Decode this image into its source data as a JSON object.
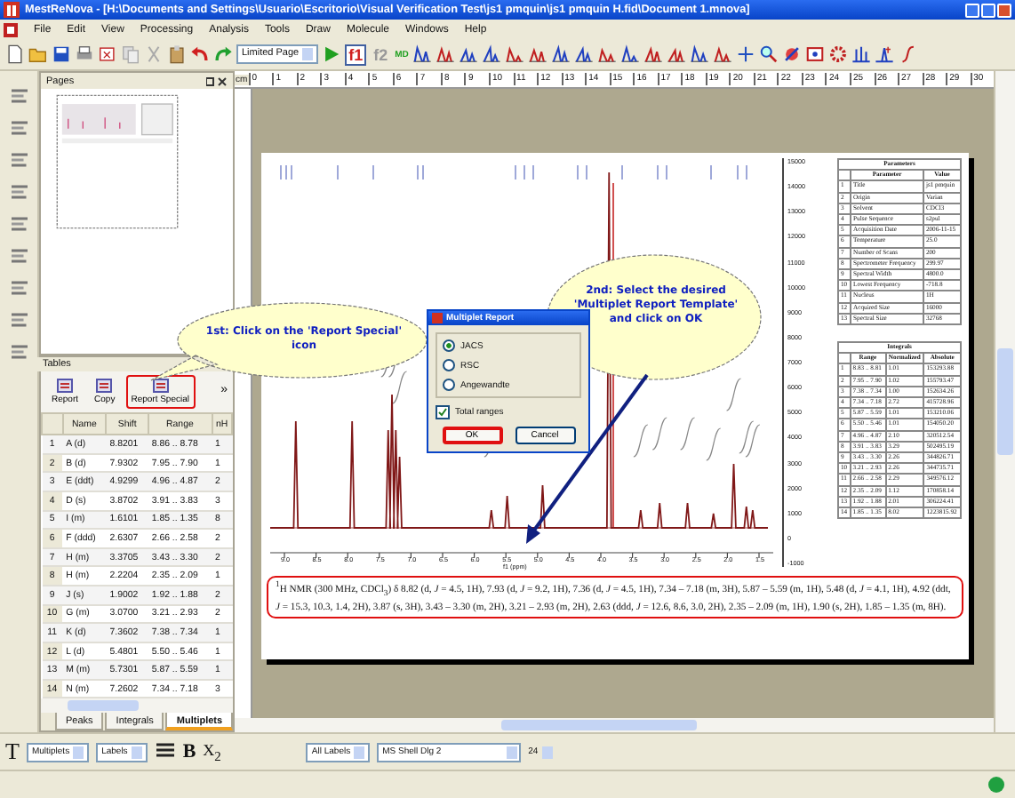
{
  "window": {
    "title": "MestReNova - [H:\\Documents and Settings\\Usuario\\Escritorio\\Visual Verification Test\\js1 pmquin\\js1 pmquin H.fid\\Document 1.mnova]"
  },
  "menu": [
    "File",
    "Edit",
    "View",
    "Processing",
    "Analysis",
    "Tools",
    "Draw",
    "Molecule",
    "Windows",
    "Help"
  ],
  "toolbar": {
    "page_mode": "Limited Page",
    "dimension_buttons": [
      {
        "label": "f1",
        "selected": true
      },
      {
        "label": "f2",
        "selected": false
      }
    ],
    "md_button": "MD"
  },
  "ruler": {
    "unit": "cm",
    "marks": [
      "0",
      "1",
      "2",
      "3",
      "4",
      "5",
      "6",
      "7",
      "8",
      "9",
      "10",
      "11",
      "12",
      "13",
      "14",
      "15",
      "16",
      "17",
      "18",
      "19",
      "20",
      "21",
      "22",
      "23",
      "24",
      "25",
      "26",
      "27",
      "28",
      "29",
      "30"
    ]
  },
  "pages_panel": {
    "title": "Pages"
  },
  "tables_panel": {
    "title": "Tables",
    "more": "»",
    "buttons": [
      {
        "label": "Report",
        "highlighted": false
      },
      {
        "label": "Copy",
        "highlighted": false
      },
      {
        "label": "Report Special",
        "highlighted": true
      }
    ],
    "columns": [
      "Name",
      "Shift",
      "Range",
      "nH"
    ],
    "rows": [
      {
        "index": "1",
        "name": "A (d)",
        "shift": "8.8201",
        "range": "8.86 .. 8.78",
        "nh": "1"
      },
      {
        "index": "2",
        "name": "B (d)",
        "shift": "7.9302",
        "range": "7.95 .. 7.90",
        "nh": "1"
      },
      {
        "index": "3",
        "name": "E (ddt)",
        "shift": "4.9299",
        "range": "4.96 .. 4.87",
        "nh": "2"
      },
      {
        "index": "4",
        "name": "D (s)",
        "shift": "3.8702",
        "range": "3.91 .. 3.83",
        "nh": "3"
      },
      {
        "index": "5",
        "name": "I (m)",
        "shift": "1.6101",
        "range": "1.85 .. 1.35",
        "nh": "8"
      },
      {
        "index": "6",
        "name": "F (ddd)",
        "shift": "2.6307",
        "range": "2.66 .. 2.58",
        "nh": "2"
      },
      {
        "index": "7",
        "name": "H (m)",
        "shift": "3.3705",
        "range": "3.43 .. 3.30",
        "nh": "2"
      },
      {
        "index": "8",
        "name": "H (m)",
        "shift": "2.2204",
        "range": "2.35 .. 2.09",
        "nh": "1"
      },
      {
        "index": "9",
        "name": "J (s)",
        "shift": "1.9002",
        "range": "1.92 .. 1.88",
        "nh": "2"
      },
      {
        "index": "10",
        "name": "G (m)",
        "shift": "3.0700",
        "range": "3.21 .. 2.93",
        "nh": "2"
      },
      {
        "index": "11",
        "name": "K (d)",
        "shift": "7.3602",
        "range": "7.38 .. 7.34",
        "nh": "1"
      },
      {
        "index": "12",
        "name": "L (d)",
        "shift": "5.4801",
        "range": "5.50 .. 5.46",
        "nh": "1"
      },
      {
        "index": "13",
        "name": "M (m)",
        "shift": "5.7301",
        "range": "5.87 .. 5.59",
        "nh": "1"
      },
      {
        "index": "14",
        "name": "N (m)",
        "shift": "7.2602",
        "range": "7.34 .. 7.18",
        "nh": "3"
      }
    ],
    "tabs": [
      {
        "label": "Peaks",
        "selected": false
      },
      {
        "label": "Integrals",
        "selected": false
      },
      {
        "label": "Multiplets",
        "selected": true
      }
    ]
  },
  "document": {
    "spectrum": {
      "xticks": [
        "9.0",
        "8.5",
        "8.0",
        "7.5",
        "7.0",
        "6.5",
        "6.0",
        "5.5",
        "5.0",
        "4.5",
        "4.0",
        "3.5",
        "3.0",
        "2.5",
        "2.0",
        "1.5"
      ],
      "xlabel": "f1 (ppm)",
      "yticks": [
        "15000",
        "14000",
        "13000",
        "12000",
        "11000",
        "10000",
        "9000",
        "8000",
        "7000",
        "6000",
        "5000",
        "4000",
        "3000",
        "2000",
        "1000",
        "0",
        "-1000"
      ]
    },
    "parameters": {
      "title": "Parameters",
      "columns": [
        "",
        "Parameter",
        "Value"
      ],
      "rows": [
        [
          "1",
          "Title",
          "js1 pmquin"
        ],
        [
          "2",
          "Origin",
          "Varian"
        ],
        [
          "3",
          "Solvent",
          "CDCl3"
        ],
        [
          "4",
          "Pulse Sequence",
          "s2pul"
        ],
        [
          "5",
          "Acquisition Date",
          "2006-11-15"
        ],
        [
          "6",
          "Temperature",
          "25.0"
        ],
        [
          "7",
          "Number of Scans",
          "200"
        ],
        [
          "8",
          "Spectrometer Frequency",
          "299.97"
        ],
        [
          "9",
          "Spectral Width",
          "4800.0"
        ],
        [
          "10",
          "Lowest Frequency",
          "-718.8"
        ],
        [
          "11",
          "Nucleus",
          "1H"
        ],
        [
          "12",
          "Acquired Size",
          "16000"
        ],
        [
          "13",
          "Spectral Size",
          "32768"
        ]
      ]
    },
    "integrals": {
      "title": "Integrals",
      "columns": [
        "",
        "Range",
        "Normalized",
        "Absolute"
      ],
      "rows": [
        [
          "1",
          "8.83 .. 8.81",
          "1.01",
          "153293.88"
        ],
        [
          "2",
          "7.95 .. 7.90",
          "1.02",
          "155793.47"
        ],
        [
          "3",
          "7.38 .. 7.34",
          "1.00",
          "152634.26"
        ],
        [
          "4",
          "7.34 .. 7.18",
          "2.72",
          "415728.96"
        ],
        [
          "5",
          "5.87 .. 5.59",
          "1.01",
          "153210.06"
        ],
        [
          "6",
          "5.50 .. 5.46",
          "1.01",
          "154050.20"
        ],
        [
          "7",
          "4.96 .. 4.87",
          "2.10",
          "320512.54"
        ],
        [
          "8",
          "3.91 .. 3.83",
          "3.29",
          "502495.19"
        ],
        [
          "9",
          "3.43 .. 3.30",
          "2.26",
          "344826.71"
        ],
        [
          "10",
          "3.21 .. 2.93",
          "2.26",
          "344735.71"
        ],
        [
          "11",
          "2.66 .. 2.58",
          "2.29",
          "349576.12"
        ],
        [
          "12",
          "2.35 .. 2.09",
          "1.12",
          "170858.14"
        ],
        [
          "13",
          "1.92 .. 1.88",
          "2.01",
          "306224.41"
        ],
        [
          "14",
          "1.85 .. 1.35",
          "8.02",
          "1223815.92"
        ]
      ]
    },
    "nmr_text": "$^{1}$H NMR (300 MHz, CDCl$_{3}$) δ 8.82 (d, *J* = 4.5, 1H), 7.93 (d, *J* = 9.2, 1H), 7.36 (d, *J* = 4.5, 1H), 7.34 – 7.18 (m, 3H), 5.87 – 5.59 (m, 1H), 5.48 (d, *J* = 4.1, 1H), 4.92 (ddt, *J* = 15.3, 10.3, 1.4, 2H), 3.87 (s, 3H), 3.43 – 3.30 (m, 2H), 3.21 – 2.93 (m, 2H), 2.63 (ddd, *J* = 12.6, 8.6, 3.0, 2H), 2.35 – 2.09 (m, 1H), 1.90 (s, 2H), 1.85 – 1.35 (m, 8H).",
    "nmr_highlighted": true
  },
  "dialog": {
    "title": "Multiplet Report",
    "templates": [
      {
        "label": "JACS",
        "selected": true
      },
      {
        "label": "RSC",
        "selected": false
      },
      {
        "label": "Angewandte",
        "selected": false
      }
    ],
    "total_ranges": {
      "label": "Total ranges",
      "checked": true
    },
    "buttons": [
      {
        "label": "OK",
        "highlighted": true
      },
      {
        "label": "Cancel",
        "highlighted": false
      }
    ]
  },
  "callouts": [
    {
      "text": "1st: Click on the 'Report Special' icon"
    },
    {
      "text": "2nd: Select the desired 'Multiplet Report Template' and click on OK"
    }
  ],
  "bottom_toolbar": {
    "text_tool": "T",
    "layer_select": "Multiplets",
    "label_select": "Labels",
    "bold": "B",
    "subscript": "X$_{2}$",
    "label_scope": "All Labels",
    "font": "MS Shell Dlg 2",
    "font_size": "24"
  }
}
